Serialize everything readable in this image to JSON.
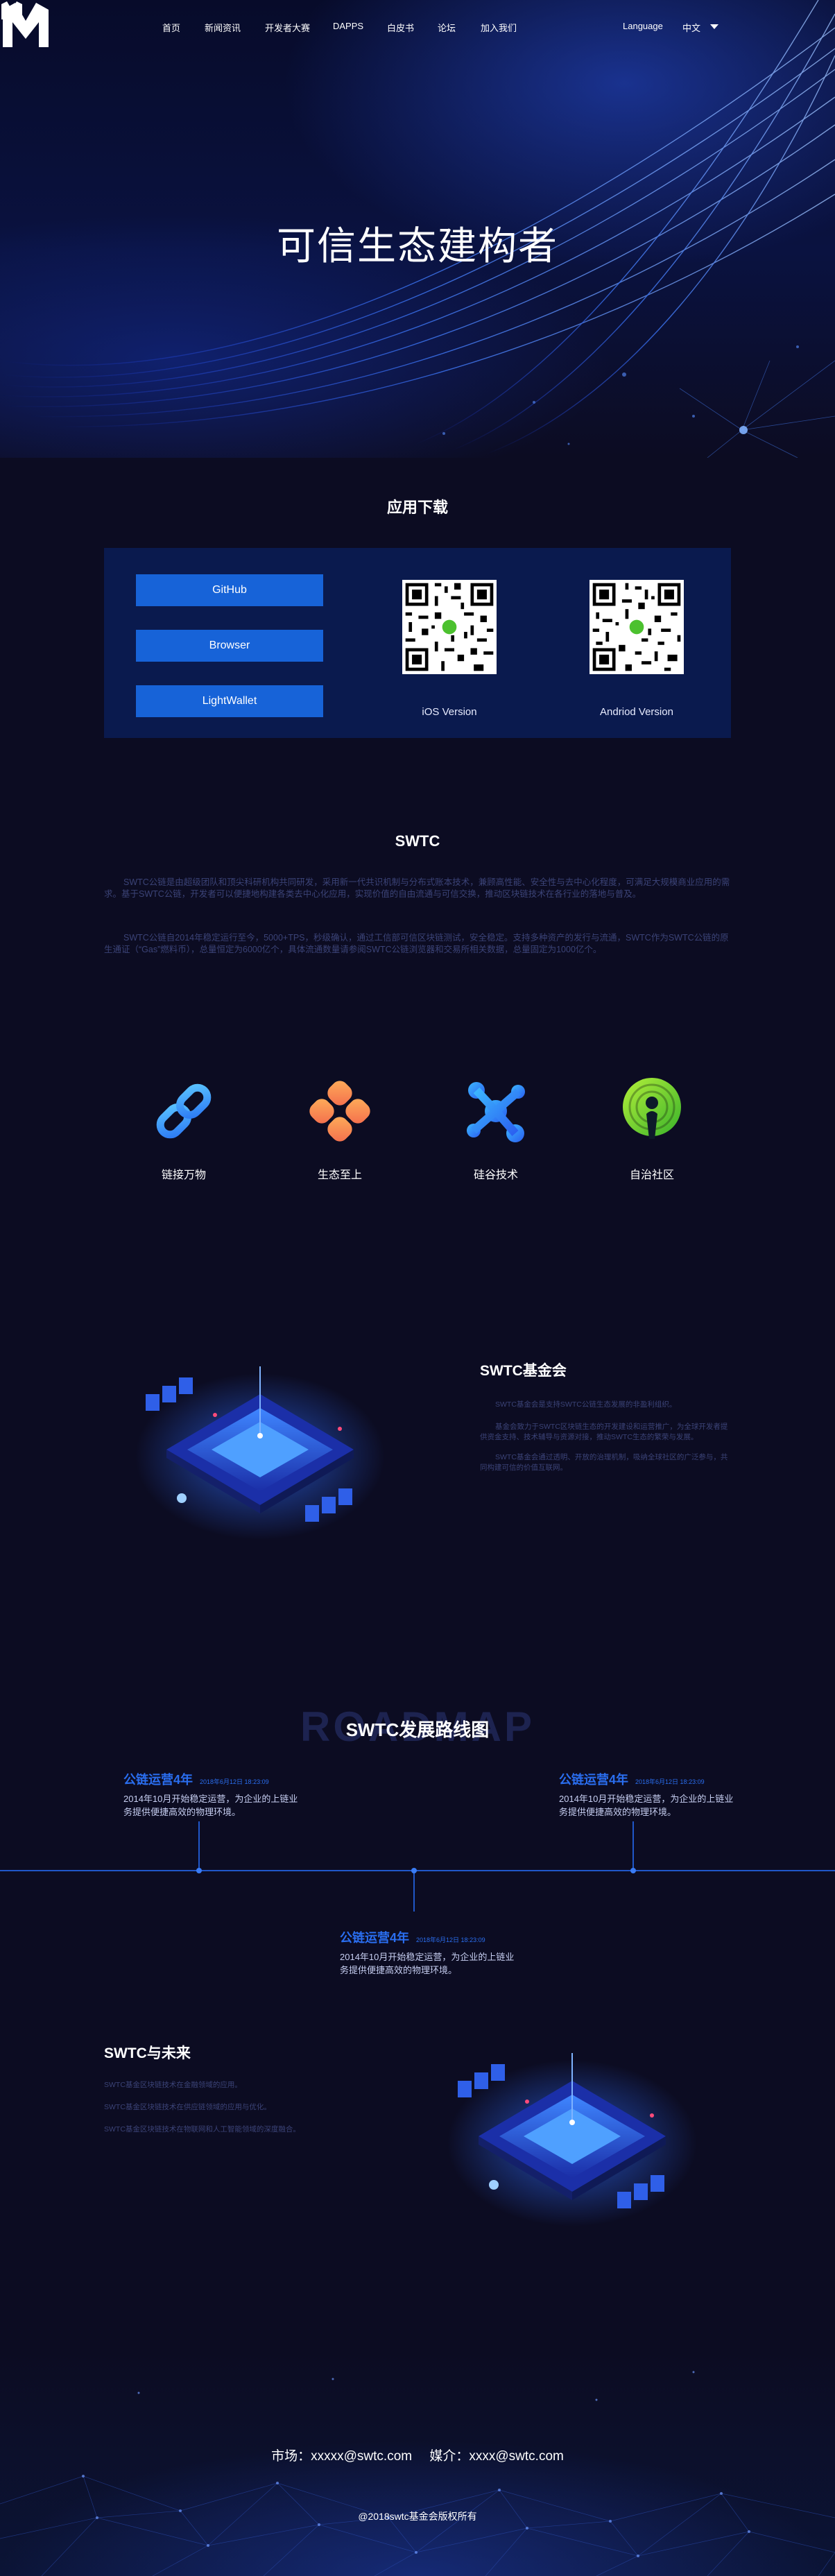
{
  "nav": {
    "items": [
      "首页",
      "新闻资讯",
      "开发者大赛",
      "DAPPS",
      "白皮书",
      "论坛",
      "加入我们"
    ],
    "language_label": "Language",
    "language_value": "中文"
  },
  "hero": {
    "title": "可信生态建构者"
  },
  "download": {
    "title": "应用下载",
    "buttons": [
      "GitHub",
      "Browser",
      "LightWallet"
    ],
    "qr_labels": [
      "iOS Version",
      "Andriod Version"
    ]
  },
  "swtc": {
    "title": "SWTC",
    "paragraphs": [
      "SWTC公链是由超级团队和顶尖科研机构共同研发，采用新一代共识机制与分布式账本技术，兼顾高性能、安全性与去中心化程度，可满足大规模商业应用的需求。基于SWTC公链，开发者可以便捷地构建各类去中心化应用，实现价值的自由流通与可信交换，推动区块链技术在各行业的落地与普及。",
      "SWTC公链自2014年稳定运行至今，5000+TPS，秒级确认，通过工信部可信区块链测试，安全稳定。支持多种资产的发行与流通，SWTC作为SWTC公链的原生通证（“Gas”燃料币），总量恒定为6000亿个，具体流通数量请参阅SWTC公链浏览器和交易所相关数据，总量固定为1000亿个。"
    ]
  },
  "features": [
    {
      "label": "链接万物",
      "icon": "link-icon"
    },
    {
      "label": "生态至上",
      "icon": "ecology-icon"
    },
    {
      "label": "硅谷技术",
      "icon": "technology-icon"
    },
    {
      "label": "自治社区",
      "icon": "community-icon"
    }
  ],
  "foundation": {
    "title": "SWTC基金会",
    "paragraphs": [
      "SWTC基金会是支持SWTC公链生态发展的非盈利组织。",
      "基金会致力于SWTC区块链生态的开发建设和运营推广，为全球开发者提供资金支持、技术辅导与资源对接，推动SWTC生态的繁荣与发展。",
      "SWTC基金会通过透明、开放的治理机制，吸纳全球社区的广泛参与，共同构建可信的价值互联网。"
    ]
  },
  "roadmap": {
    "bg_text": "ROADMAP",
    "title": "SWTC发展路线图",
    "items": [
      {
        "title": "公链运营4年",
        "date": "2018年6月12日 18:23:09",
        "desc": "2014年10月开始稳定运营，为企业的上链业务提供便捷高效的物理环境。"
      },
      {
        "title": "公链运营4年",
        "date": "2018年6月12日 18:23:09",
        "desc": "2014年10月开始稳定运营，为企业的上链业务提供便捷高效的物理环境。"
      },
      {
        "title": "公链运营4年",
        "date": "2018年6月12日 18:23:09",
        "desc": "2014年10月开始稳定运营，为企业的上链业务提供便捷高效的物理环境。"
      }
    ]
  },
  "future": {
    "title": "SWTC与未来",
    "lines": [
      "SWTC基金区块链技术在金融领域的应用。",
      "SWTC基金区块链技术在供应链领域的应用与优化。",
      "SWTC基金区块链技术在物联网和人工智能领域的深度融合。"
    ]
  },
  "footer": {
    "market": "市场：xxxxx@swtc.com",
    "media": "媒介：xxxx@swtc.com",
    "copyright": "@2018swtc基金会版权所有"
  },
  "colors": {
    "background": "#0c0c22",
    "accent": "#1763d8",
    "panel": "#0a1a4e",
    "muted_text": "#3b4377"
  }
}
